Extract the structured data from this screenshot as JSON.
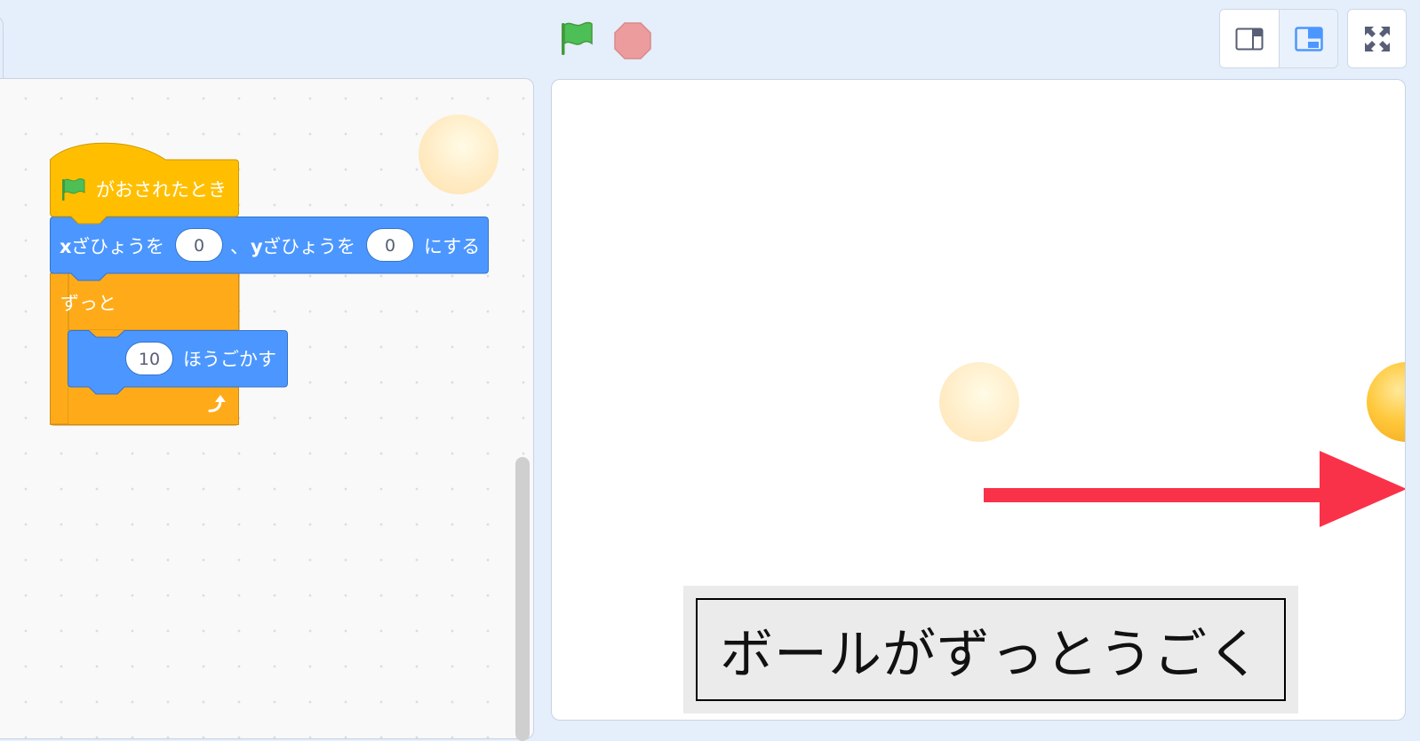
{
  "blocks": {
    "hat_label": "がおされたとき",
    "goto": {
      "x_prefix": "x",
      "x_label": "ざひょうを",
      "x_value": "0",
      "separator": "、",
      "y_prefix": "y",
      "y_label": "ざひょうを",
      "y_value": "0",
      "suffix": "にする"
    },
    "forever_label": "ずっと",
    "move": {
      "steps": "10",
      "label": "ほうごかす"
    }
  },
  "stage": {
    "caption": "ボールがずっとうごく"
  },
  "colors": {
    "events": "#ffbf00",
    "motion": "#4c97ff",
    "control": "#ffab19",
    "arrow": "#f93249",
    "flag": "#4cbf56",
    "stop": "#ec9c9c"
  },
  "icons": [
    "green-flag-icon",
    "stop-icon",
    "small-stage-icon",
    "normal-stage-icon",
    "fullscreen-icon",
    "repeat-arrow-icon"
  ]
}
